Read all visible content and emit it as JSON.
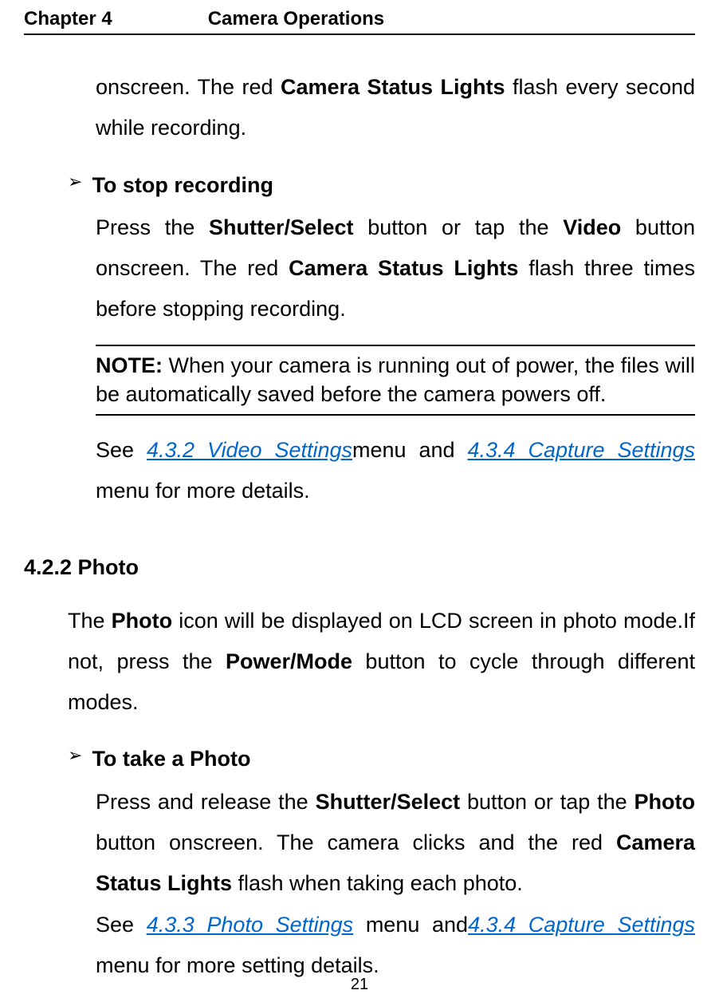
{
  "header": {
    "chapter": "Chapter 4",
    "title": "Camera Operations"
  },
  "para1": {
    "pre": "onscreen. The red ",
    "bold1": "Camera Status Lights",
    "post": " flash every second while recording."
  },
  "bullet1": {
    "marker": "➢",
    "label": "To stop recording"
  },
  "para2": {
    "t1": "Press the ",
    "b1": "Shutter/Select",
    "t2": " button or tap the ",
    "b2": "Video",
    "t3": " button onscreen. The red ",
    "b3": "Camera Status Lights",
    "t4": " flash three times before stopping recording."
  },
  "note": {
    "label": "NOTE:",
    "text": " When your camera is running out of power, the files will be automatically saved before the camera powers off."
  },
  "para3": {
    "t1": "See ",
    "link1": "4.3.2 Video Settings",
    "t2": "menu and ",
    "link2": "4.3.4 Capture Settings",
    "t3": " menu for more details."
  },
  "section": {
    "heading": "4.2.2 Photo"
  },
  "para4": {
    "t1": "The ",
    "b1": "Photo",
    "t2": " icon will be displayed on LCD screen in photo mode.If not, press the ",
    "b2": "Power/Mode",
    "t3": " button to cycle through different modes."
  },
  "bullet2": {
    "marker": "➢",
    "label": "To take a Photo"
  },
  "para5": {
    "t1": "Press and release the ",
    "b1": "Shutter/Select",
    "t2": " button or tap the ",
    "b2": "Photo",
    "t3": " button onscreen. The camera clicks and the red ",
    "b3": "Camera Status Lights",
    "t4": " flash when taking each photo."
  },
  "para6": {
    "t1": "See ",
    "link1": "4.3.3 Photo Settings",
    "t2": " menu and",
    "link2": "4.3.4 Capture Settings",
    "t3": " menu for more setting details."
  },
  "page_number": "21"
}
